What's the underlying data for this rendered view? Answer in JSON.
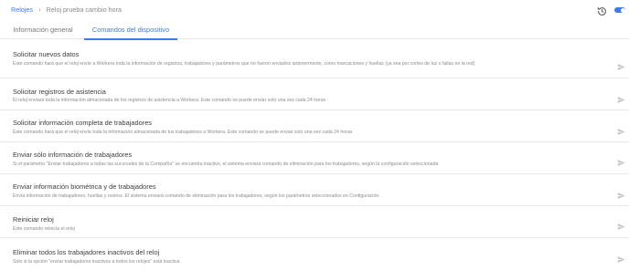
{
  "breadcrumb": {
    "root": "Relojes",
    "separator": "›",
    "current": "Reloj prueba cambio hora"
  },
  "header": {
    "history_icon": "history-icon",
    "toggle_on": true
  },
  "tabs": [
    {
      "label": "Información general",
      "active": false
    },
    {
      "label": "Comandos del dispositivo",
      "active": true
    }
  ],
  "commands": [
    {
      "title": "Solicitar nuevos datos",
      "description": "Este comando hará que el reloj envíe a Workera toda la información de registros, trabajadores y parámetros que no fueron enviados anteriormente, como marcaciones y huellas (ya sea por cortes de luz o fallas en la red)"
    },
    {
      "title": "Solicitar registros de asistencia",
      "description": "El reloj enviará toda la información almacenada de los registros de asistencia a Workera. Este comando se puede enviar solo una vez cada 24 horas"
    },
    {
      "title": "Solicitar información completa de trabajadores",
      "description": "Este comando hará que el reloj envíe toda la información almacenada de tus trabajadores a Workera. Este comando se puede enviar solo una vez cada 24 horas"
    },
    {
      "title": "Enviar sólo información de trabajadores",
      "description": "Si el parámetro \"Enviar trabajadores a todas las sucursales de la Compañía\" se encuentra inactivo, el sistema enviará comando de eliminación para los trabajadores, según la configuración seleccionada"
    },
    {
      "title": "Enviar información biométrica y de trabajadores",
      "description": "Envía información de trabajadores, huellas y rostros. El sistema enviará comando de eliminación para los trabajadores, según los parámetros seleccionados en Configuración."
    },
    {
      "title": "Reiniciar reloj",
      "description": "Este comando reinicia el reloj"
    },
    {
      "title": "Eliminar todos los trabajadores inactivos del reloj",
      "description": "Solo si la opción \"enviar trabajadores inactivos a todos los relojes\" está inactiva"
    }
  ],
  "send_icon": "send-icon",
  "colors": {
    "accent": "#3d7ce6",
    "icon_gray": "#c4c4c4",
    "divider": "#e8e8e8"
  }
}
